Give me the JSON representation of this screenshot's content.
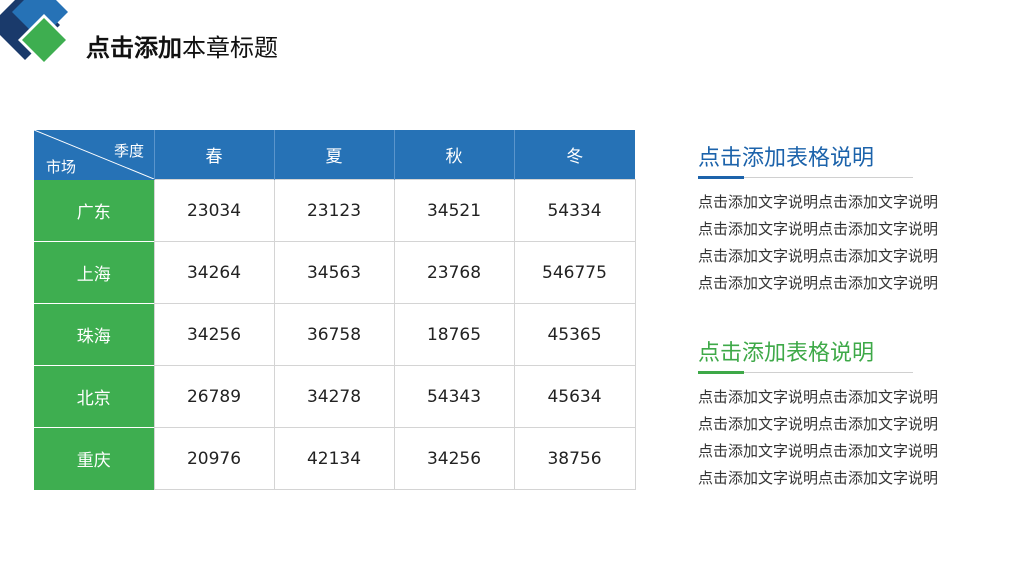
{
  "slide": {
    "title_bold": "点击添加",
    "title_regular": "本章标题"
  },
  "colors": {
    "blue": "#2672b6",
    "green": "#3eae50",
    "navy": "#1a3a6b"
  },
  "table": {
    "corner_top": "季度",
    "corner_bottom": "市场",
    "columns": [
      "春",
      "夏",
      "秋",
      "冬"
    ],
    "rows": [
      {
        "market": "广东",
        "values": [
          "23034",
          "23123",
          "34521",
          "54334"
        ]
      },
      {
        "market": "上海",
        "values": [
          "34264",
          "34563",
          "23768",
          "546775"
        ]
      },
      {
        "market": "珠海",
        "values": [
          "34256",
          "36758",
          "18765",
          "45365"
        ]
      },
      {
        "market": "北京",
        "values": [
          "26789",
          "34278",
          "54343",
          "45634"
        ]
      },
      {
        "market": "重庆",
        "values": [
          "20976",
          "42134",
          "34256",
          "38756"
        ]
      }
    ]
  },
  "notes": [
    {
      "heading": "点击添加表格说明",
      "lines": [
        "点击添加文字说明点击添加文字说明",
        "点击添加文字说明点击添加文字说明",
        "点击添加文字说明点击添加文字说明",
        "点击添加文字说明点击添加文字说明"
      ]
    },
    {
      "heading": "点击添加表格说明",
      "lines": [
        "点击添加文字说明点击添加文字说明",
        "点击添加文字说明点击添加文字说明",
        "点击添加文字说明点击添加文字说明",
        "点击添加文字说明点击添加文字说明"
      ]
    }
  ]
}
